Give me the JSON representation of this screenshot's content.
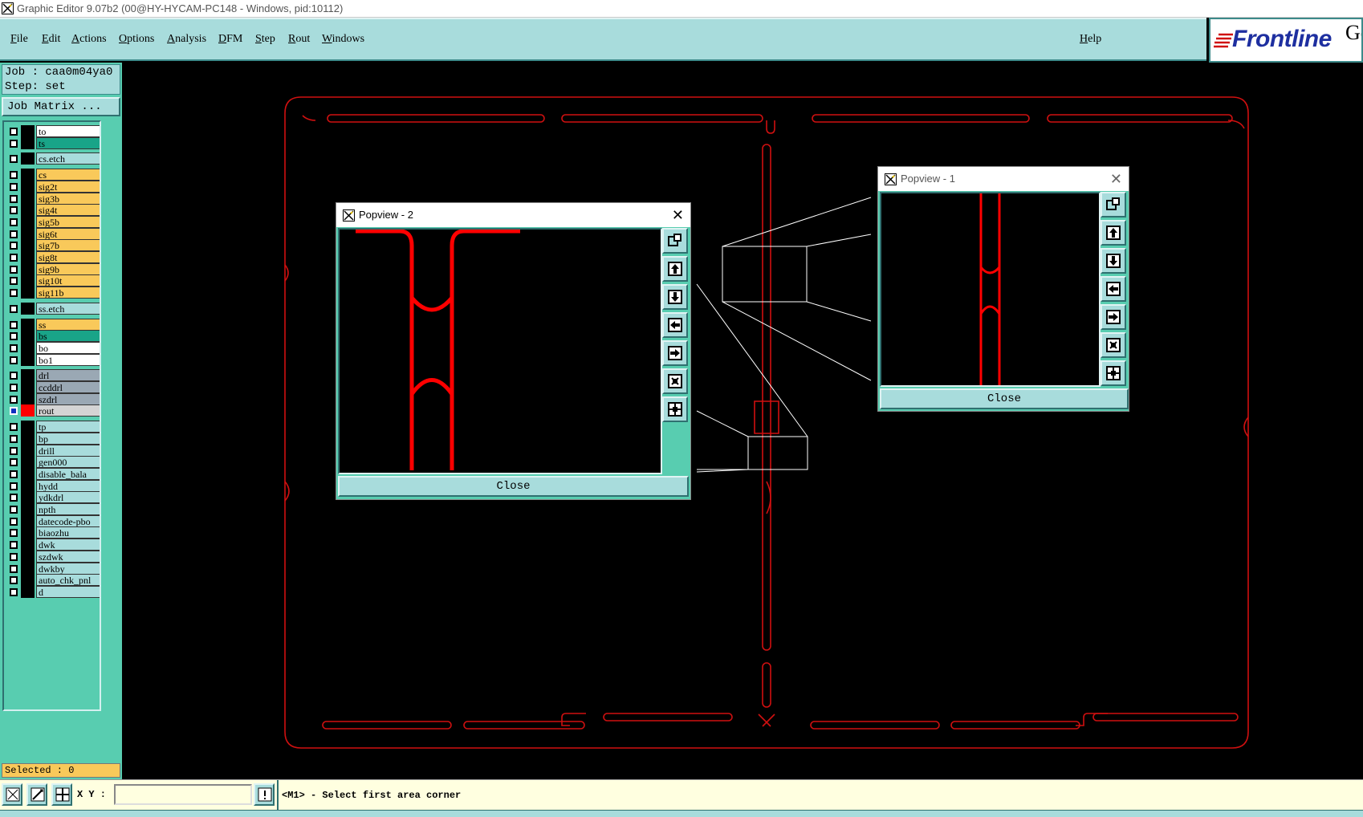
{
  "window": {
    "title": "Graphic Editor 9.07b2 (00@HY-HYCAM-PC148 - Windows, pid:10112)"
  },
  "menubar": {
    "items": [
      "File",
      "Edit",
      "Actions",
      "Options",
      "Analysis",
      "DFM",
      "Step",
      "Rout",
      "Windows"
    ],
    "help": "Help",
    "logo_text": "Frontline",
    "logo_extra": "Ge"
  },
  "job": {
    "job_line": "Job : caa0m04ya0",
    "step_line": "Step: set",
    "matrix_button": "Job Matrix ..."
  },
  "layers": [
    {
      "name": "to",
      "color": "#ffffff"
    },
    {
      "name": "ts",
      "color": "#19a488"
    },
    {
      "name": "cs.etch",
      "color": "#a8dcdc"
    },
    {
      "name": "cs",
      "color": "#f9c95a"
    },
    {
      "name": "sig2t",
      "color": "#f9c95a"
    },
    {
      "name": "sig3b",
      "color": "#f9c95a"
    },
    {
      "name": "sig4t",
      "color": "#f9c95a"
    },
    {
      "name": "sig5b",
      "color": "#f9c95a"
    },
    {
      "name": "sig6t",
      "color": "#f9c95a"
    },
    {
      "name": "sig7b",
      "color": "#f9c95a"
    },
    {
      "name": "sig8t",
      "color": "#f9c95a"
    },
    {
      "name": "sig9b",
      "color": "#f9c95a"
    },
    {
      "name": "sig10t",
      "color": "#f9c95a"
    },
    {
      "name": "sig11b",
      "color": "#f9c95a"
    },
    {
      "name": "ss.etch",
      "color": "#a8dcdc"
    },
    {
      "name": "ss",
      "color": "#f9c95a"
    },
    {
      "name": "bs",
      "color": "#19a488"
    },
    {
      "name": "bo",
      "color": "#ffffff"
    },
    {
      "name": "bo1",
      "color": "#ffffff"
    },
    {
      "name": "drl",
      "color": "#9aa8b4"
    },
    {
      "name": "ccddrl",
      "color": "#9aa8b4"
    },
    {
      "name": "szdrl",
      "color": "#9aa8b4"
    },
    {
      "name": "rout",
      "color": "#d4d4d4",
      "selected": true
    },
    {
      "name": "tp",
      "color": "#a8dcdc"
    },
    {
      "name": "bp",
      "color": "#a8dcdc"
    },
    {
      "name": "drill",
      "color": "#a8dcdc"
    },
    {
      "name": "gen000",
      "color": "#a8dcdc"
    },
    {
      "name": "disable_bala",
      "color": "#a8dcdc"
    },
    {
      "name": "hydd",
      "color": "#a8dcdc"
    },
    {
      "name": "ydkdrl",
      "color": "#a8dcdc"
    },
    {
      "name": "npth",
      "color": "#a8dcdc"
    },
    {
      "name": "datecode-pbo",
      "color": "#a8dcdc"
    },
    {
      "name": "biaozhu",
      "color": "#a8dcdc"
    },
    {
      "name": "dwk",
      "color": "#a8dcdc"
    },
    {
      "name": "szdwk",
      "color": "#a8dcdc"
    },
    {
      "name": "dwkby",
      "color": "#a8dcdc"
    },
    {
      "name": "auto_chk_pnl",
      "color": "#a8dcdc"
    },
    {
      "name": "d",
      "color": "#a8dcdc"
    }
  ],
  "selected_text": "Selected : 0",
  "popview_2": {
    "title": "Popview - 2",
    "close_button": "Close"
  },
  "popview_1": {
    "title": "Popview - 1",
    "close_button": "Close"
  },
  "status": {
    "xy_label": "X Y :",
    "xy_value": "",
    "message": "<M1> - Select first area corner"
  },
  "colors": {
    "panel_green": "#58cdb0",
    "panel_cyan": "#a8dcdc",
    "rout_red": "#ff0000",
    "outline_red": "#d01010"
  },
  "icons": [
    "zoom-window-icon",
    "pan-up-icon",
    "pan-down-icon",
    "pan-left-icon",
    "pan-right-icon",
    "zoom-out-icon",
    "zoom-fit-icon"
  ]
}
